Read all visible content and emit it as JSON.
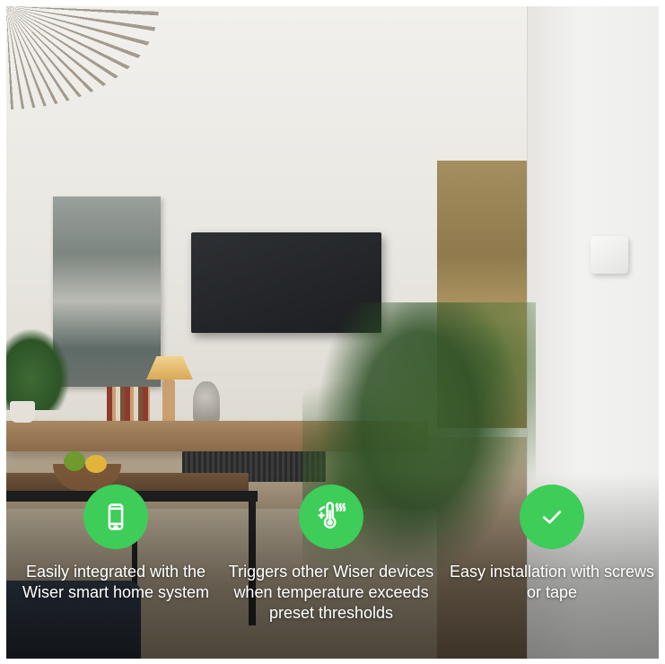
{
  "brand": {
    "accent_color": "#3dcd58"
  },
  "features": [
    {
      "icon": "smartphone-icon",
      "text": "Easily integrated with the Wiser smart home system"
    },
    {
      "icon": "thermometer-heat-icon",
      "text": "Triggers other Wiser devices when temperature exceeds preset thresholds"
    },
    {
      "icon": "checkmark-icon",
      "text": "Easy installation with screws or tape"
    }
  ]
}
